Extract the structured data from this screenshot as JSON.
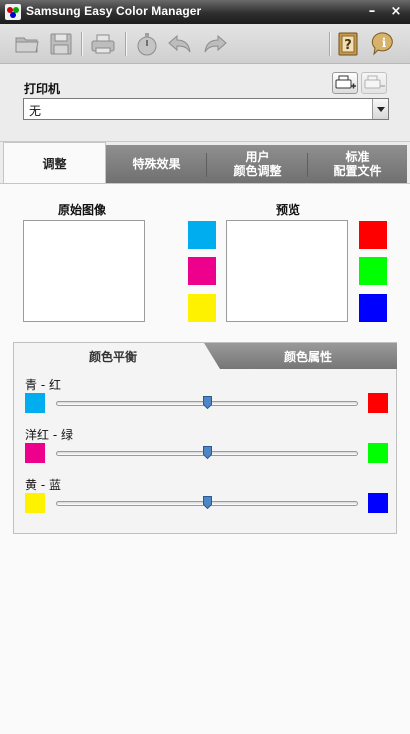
{
  "window": {
    "title": "Samsung Easy Color Manager",
    "minimize": "–",
    "close": "×"
  },
  "toolbar": {
    "icons": [
      "open-folder-icon",
      "save-disk-icon",
      "print-icon",
      "timer-icon",
      "undo-icon",
      "redo-icon",
      "help-book-icon",
      "info-icon"
    ]
  },
  "printer": {
    "label": "打印机",
    "selected": "无",
    "buttons": [
      "add-printer-icon",
      "remove-printer-icon"
    ]
  },
  "tabs": [
    {
      "label": "调整",
      "active": true
    },
    {
      "label": "特殊效果",
      "active": false
    },
    {
      "label": "用户\n颜色调整",
      "line1": "用户",
      "line2": "颜色调整",
      "active": false
    },
    {
      "label": "标准\n配置文件",
      "line1": "标准",
      "line2": "配置文件",
      "active": false
    }
  ],
  "original": {
    "title": "原始图像"
  },
  "preview": {
    "title": "预览"
  },
  "swatches_left": [
    "#00aeef",
    "#ec008c",
    "#fff200"
  ],
  "swatches_right": [
    "#ff0000",
    "#00ff00",
    "#0000ff"
  ],
  "subtabs": [
    {
      "label": "颜色平衡",
      "active": true
    },
    {
      "label": "颜色属性",
      "active": false
    }
  ],
  "sliders": [
    {
      "label": "青 - 红",
      "left_color": "#00aeef",
      "right_color": "#ff0000",
      "value": 0.5
    },
    {
      "label": "洋红 - 绿",
      "left_color": "#ec008c",
      "right_color": "#00ff00",
      "value": 0.5
    },
    {
      "label": "黄 - 蓝",
      "left_color": "#fff200",
      "right_color": "#0000ff",
      "value": 0.5
    }
  ]
}
